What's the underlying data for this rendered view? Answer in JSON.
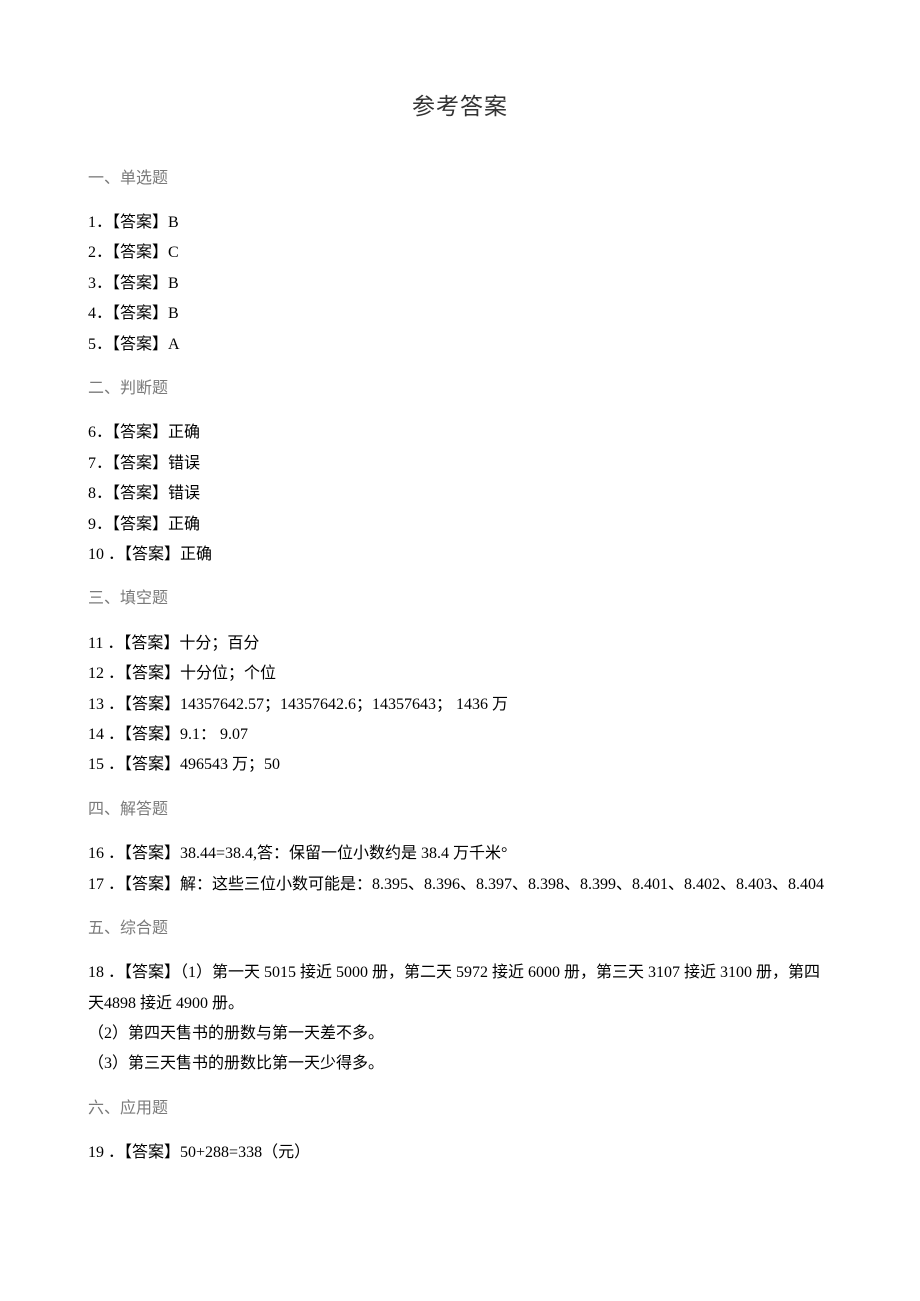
{
  "title": "参考答案",
  "sections": {
    "s1": {
      "heading": "一、单选题"
    },
    "s2": {
      "heading": "二、判断题"
    },
    "s3": {
      "heading": "三、填空题"
    },
    "s4": {
      "heading": "四、解答题"
    },
    "s5": {
      "heading": "五、综合题"
    },
    "s6": {
      "heading": "六、应用题"
    }
  },
  "items": {
    "i1": {
      "num": "1",
      "label": "．【答案】",
      "value": "B"
    },
    "i2": {
      "num": "2",
      "label": "．【答案】",
      "value": "C"
    },
    "i3": {
      "num": "3",
      "label": "．【答案】",
      "value": "B"
    },
    "i4": {
      "num": "4",
      "label": "．【答案】",
      "value": "B"
    },
    "i5": {
      "num": "5",
      "label": "．【答案】",
      "value": "A"
    },
    "i6": {
      "num": "6",
      "label": "．【答案】",
      "value": "正确"
    },
    "i7": {
      "num": "7",
      "label": "．【答案】",
      "value": "错误"
    },
    "i8": {
      "num": "8",
      "label": "．【答案】",
      "value": "错误"
    },
    "i9": {
      "num": "9",
      "label": "．【答案】",
      "value": "正确"
    },
    "i10": {
      "num": "10",
      "label": " ．【答案】",
      "value": "正确"
    },
    "i11": {
      "num": "11",
      "label": " ．【答案】",
      "value": "十分；百分"
    },
    "i12": {
      "num": "12",
      "label": " ．【答案】",
      "value": "十分位；个位"
    },
    "i13": {
      "num": "13",
      "label": " ．【答案】",
      "value": "14357642.57；14357642.6；14357643； 1436 万"
    },
    "i14": {
      "num": "14",
      "label": " ．【答案】",
      "value": "9.1： 9.07"
    },
    "i15": {
      "num": "15",
      "label": " ．【答案】",
      "value": "496543 万；50"
    },
    "i16": {
      "num": "16",
      "label": " ．【答案】",
      "value": "38.44=38.4,答：保留一位小数约是 38.4 万千米°"
    },
    "i17": {
      "num": "17",
      "label": " ．【答案】",
      "value": "解：这些三位小数可能是：8.395、8.396、8.397、8.398、8.399、8.401、8.402、8.403、8.404"
    },
    "i18": {
      "num": "18",
      "label": " ．【答案】",
      "value": "（1）第一天 5015 接近 5000 册，第二天 5972 接近 6000 册，第三天 3107 接近 3100 册，第四天4898 接近 4900 册。",
      "sub2": "（2）第四天售书的册数与第一天差不多。",
      "sub3": "（3）第三天售书的册数比第一天少得多。"
    },
    "i19": {
      "num": "19",
      "label": " ．【答案】",
      "value": "50+288=338（元）"
    }
  }
}
